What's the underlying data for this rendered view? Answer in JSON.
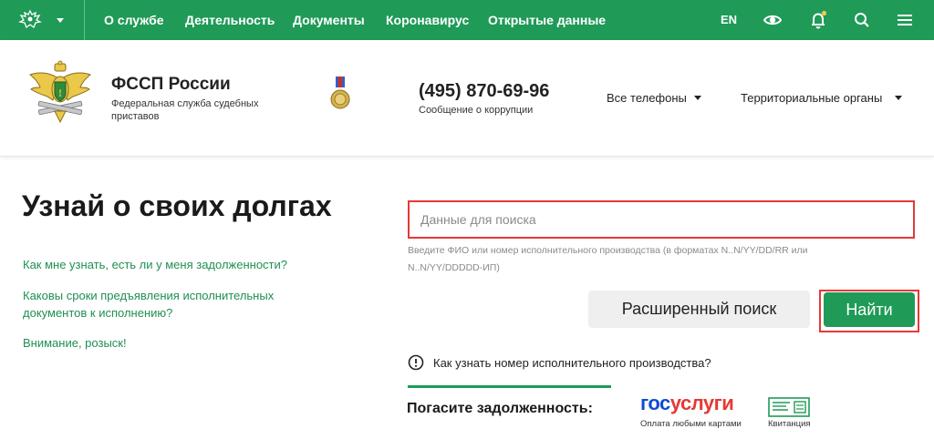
{
  "nav": {
    "items": [
      "О службе",
      "Деятельность",
      "Документы",
      "Коронавирус",
      "Открытые данные"
    ],
    "lang": "EN",
    "icons": [
      "eye-icon",
      "bell-icon",
      "search-icon",
      "menu-icon"
    ],
    "colors": {
      "nav_bg": "#1f9a57",
      "notification_dot": "#f2c94c"
    }
  },
  "header": {
    "org_name": "ФССП России",
    "org_subtitle": "Федеральная служба судебных приставов",
    "phone": "(495) 870-69-96",
    "phone_caption": "Сообщение о коррупции",
    "dropdowns": [
      "Все телефоны",
      "Территориальные органы"
    ]
  },
  "main": {
    "title": "Узнай о своих долгах",
    "links": [
      "Как мне узнать, есть ли у меня задолженности?",
      "Каковы сроки предъявления исполнительных документов к исполнению?",
      "Внимание, розыск!"
    ],
    "search": {
      "placeholder": "Данные для поиска",
      "value": "",
      "hint": "Введите ФИО или номер исполнительного производства (в форматах N..N/YY/DD/RR или N..N/YY/DDDDD-ИП)"
    },
    "advanced_search_label": "Расширенный поиск",
    "find_label": "Найти",
    "howto_label": "Как узнать номер исполнительного производства?",
    "pay": {
      "label": "Погасите задолженность:",
      "gosuslugi_part1": "гос",
      "gosuslugi_part2": "услуги",
      "gosuslugi_caption": "Оплата любыми картами",
      "receipt_caption": "Квитанция"
    },
    "colors": {
      "accent": "#1f9a57",
      "highlight_border": "#e53935",
      "link": "#1f8f52"
    }
  }
}
